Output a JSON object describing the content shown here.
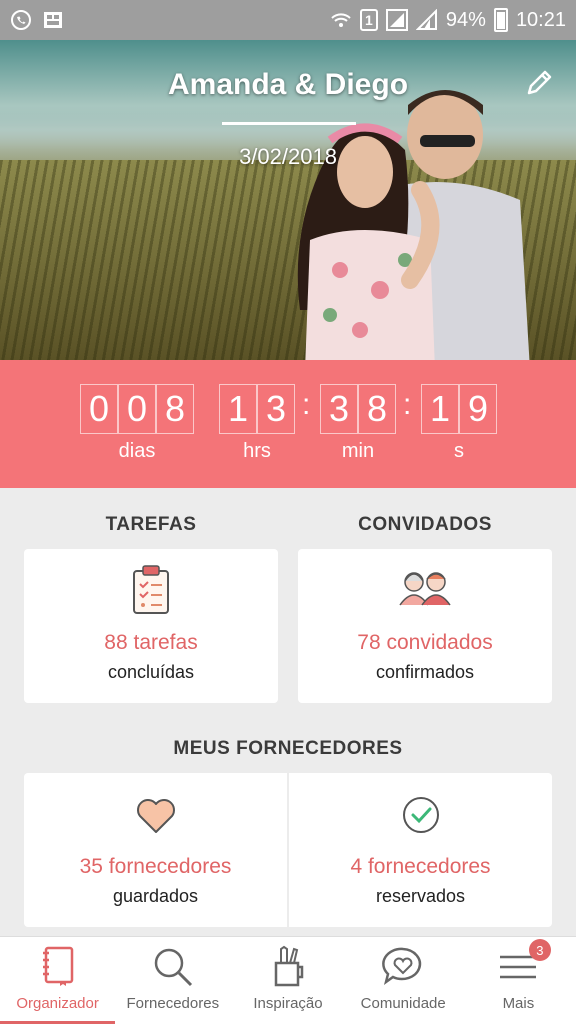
{
  "status": {
    "battery_pct": "94%",
    "time": "10:21",
    "sim_label": "1"
  },
  "hero": {
    "couple_name": "Amanda & Diego",
    "date": "3/02/2018"
  },
  "countdown": {
    "days": [
      "0",
      "0",
      "8"
    ],
    "hours": [
      "1",
      "3"
    ],
    "minutes": [
      "3",
      "8"
    ],
    "seconds": [
      "1",
      "9"
    ],
    "labels": {
      "days": "dias",
      "hours": "hrs",
      "minutes": "min",
      "seconds": "s"
    }
  },
  "sections": {
    "tarefas": {
      "title": "TAREFAS",
      "count": "88 tarefas",
      "sub": "concluídas"
    },
    "convidados": {
      "title": "CONVIDADOS",
      "count": "78 convidados",
      "sub": "confirmados"
    },
    "fornecedores": {
      "title": "MEUS FORNECEDORES",
      "saved_count": "35 fornecedores",
      "saved_sub": "guardados",
      "booked_count": "4 fornecedores",
      "booked_sub": "reservados"
    }
  },
  "nav": {
    "items": [
      {
        "label": "Organizador",
        "icon": "notebook-icon",
        "active": true
      },
      {
        "label": "Fornecedores",
        "icon": "search-icon"
      },
      {
        "label": "Inspiração",
        "icon": "pencil-cup-icon"
      },
      {
        "label": "Comunidade",
        "icon": "heart-chat-icon"
      },
      {
        "label": "Mais",
        "icon": "menu-icon",
        "badge": "3"
      }
    ]
  },
  "colors": {
    "accent": "#f47478",
    "accent_text": "#e06566"
  }
}
